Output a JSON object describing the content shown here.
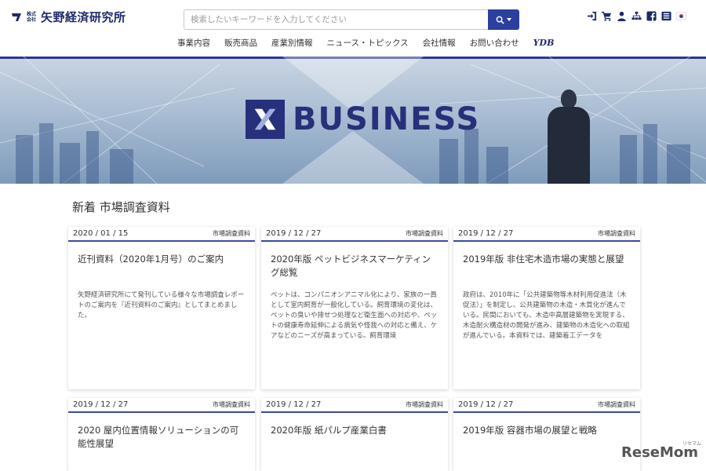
{
  "header": {
    "logo_small_top": "株式",
    "logo_small_bottom": "会社",
    "logo_name": "矢野経済研究所",
    "search_placeholder": "検索したいキーワードを入力してください",
    "util_icons": [
      "login-icon",
      "cart-icon",
      "user-icon",
      "sitemap-icon",
      "facebook-icon",
      "flag-icon",
      "korea-flag-icon"
    ]
  },
  "nav": {
    "items": [
      "事業内容",
      "販売商品",
      "産業別情報",
      "ニュース・トピックス",
      "会社情報",
      "お問い合わせ"
    ],
    "ydb": "YDB"
  },
  "hero": {
    "brand": "BUSINESS",
    "colors": {
      "brand": "#27307a",
      "accent": "#2b3f9e"
    }
  },
  "section": {
    "title": "新着 市場調査資料"
  },
  "cards": [
    {
      "date": "2020 / 01 / 15",
      "category": "市場調査資料",
      "title": "近刊資料（2020年1月号）のご案内",
      "body": "矢野経済研究所にて発刊している様々な市場調査レポートのご案内を『近刊資料のご案内』としてまとめました。"
    },
    {
      "date": "2019 / 12 / 27",
      "category": "市場調査資料",
      "title": "2020年版 ペットビジネスマーケティング総覧",
      "body": "ペットは、コンパニオンアニマル化により、家族の一員として室内飼育が一般化している。飼育環境の変化は、ペットの臭いや排せつ処理など衛生面への対応や、ペットの健康寿命延伸による病気や怪我への対応と備え、ケアなどのニーズが高まっている。飼育環境"
    },
    {
      "date": "2019 / 12 / 27",
      "category": "市場調査資料",
      "title": "2019年版 非住宅木造市場の実態と展望",
      "body": "政府は、2010年に「公共建築物等木材利用促進法（木促法）」を制定し、公共建築物の木造・木質化が進んでいる。民間においても、木造中高層建築物を実現する、木造耐火構造材の開発が進み、建築物の木造化への取組が進んでいる。本資料では、建築着工データを"
    },
    {
      "date": "2019 / 12 / 27",
      "category": "市場調査資料",
      "title": "2020 屋内位置情報ソリューションの可能性展望",
      "body": ""
    },
    {
      "date": "2019 / 12 / 27",
      "category": "市場調査資料",
      "title": "2020年版 紙パルプ産業白書",
      "body": ""
    },
    {
      "date": "2019 / 12 / 27",
      "category": "市場調査資料",
      "title": "2019年版 容器市場の展望と戦略",
      "body": ""
    }
  ],
  "watermark": {
    "text": "ReseMom",
    "sub": "リセマム"
  }
}
